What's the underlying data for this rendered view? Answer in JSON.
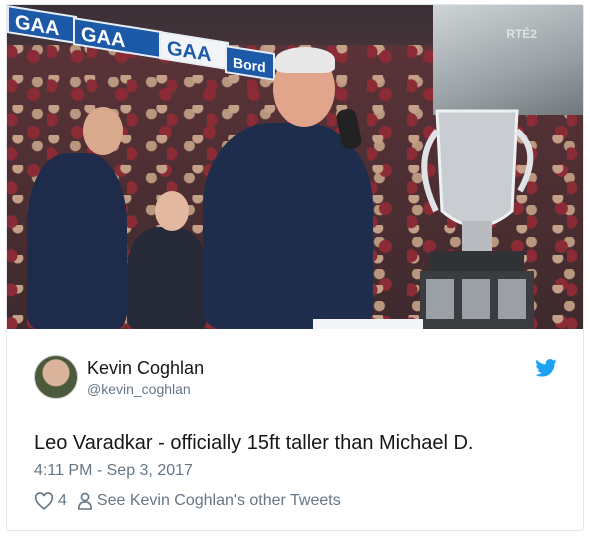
{
  "tweet": {
    "author_name": "Kevin Coghlan",
    "author_handle": "@kevin_coghlan",
    "text": "Leo Varadkar - officially 15ft taller than Michael D.",
    "timestamp": "4:11 PM - Sep 3, 2017",
    "like_count": "4",
    "other_tweets_link": "See Kevin Coghlan's other Tweets"
  },
  "photo": {
    "banners": [
      "GAA",
      "GAA",
      "GAA",
      "Bord"
    ],
    "tv_logo": "RTÉ2"
  },
  "icons": {
    "bird": "twitter-bird-icon",
    "heart": "heart-icon",
    "person": "person-icon"
  },
  "colors": {
    "twitter_blue": "#1da1f2",
    "text_primary": "#14171a",
    "text_secondary": "#657786",
    "banner_blue": "#1c5aa8"
  }
}
